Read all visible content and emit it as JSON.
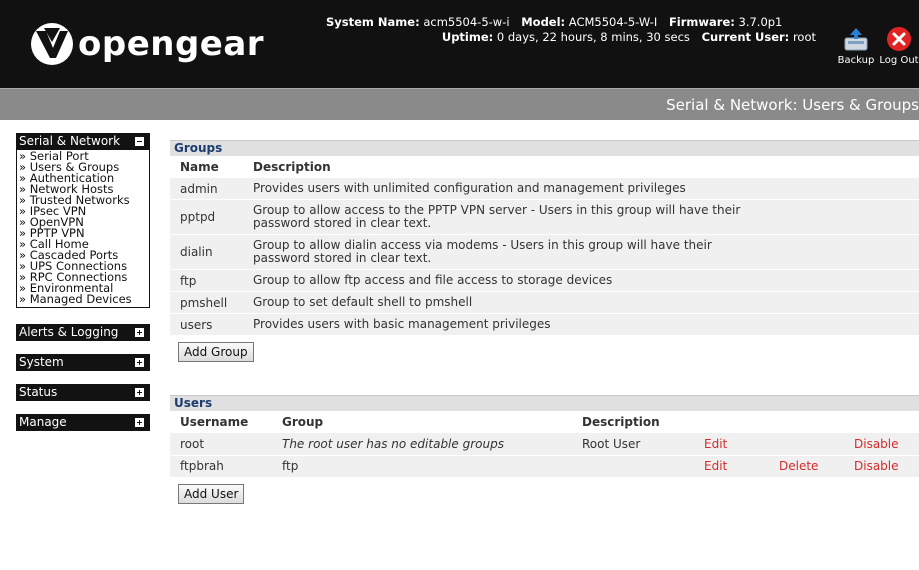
{
  "brand": {
    "name": "opengear"
  },
  "system": {
    "name_label": "System Name:",
    "name_value": "acm5504-5-w-i",
    "model_label": "Model:",
    "model_value": "ACM5504-5-W-I",
    "firmware_label": "Firmware:",
    "firmware_value": "3.7.0p1",
    "uptime_label": "Uptime:",
    "uptime_value": "0 days, 22 hours, 8 mins, 30 secs",
    "user_label": "Current User:",
    "user_value": "root"
  },
  "toolbar": {
    "backup_label": "Backup",
    "logout_label": "Log Out"
  },
  "page_title": "Serial & Network: Users & Groups",
  "sidebar": {
    "sections": [
      {
        "label": "Serial & Network",
        "expanded": true
      },
      {
        "label": "Alerts & Logging",
        "expanded": false
      },
      {
        "label": "System",
        "expanded": false
      },
      {
        "label": "Status",
        "expanded": false
      },
      {
        "label": "Manage",
        "expanded": false
      }
    ],
    "items": [
      "Serial Port",
      "Users & Groups",
      "Authentication",
      "Network Hosts",
      "Trusted Networks",
      "IPsec VPN",
      "OpenVPN",
      "PPTP VPN",
      "Call Home",
      "Cascaded Ports",
      "UPS Connections",
      "RPC Connections",
      "Environmental",
      "Managed Devices"
    ]
  },
  "groups": {
    "title": "Groups",
    "headers": {
      "name": "Name",
      "description": "Description"
    },
    "rows": [
      {
        "name": "admin",
        "desc1": "Provides users with unlimited configuration and management privileges",
        "desc2": ""
      },
      {
        "name": "pptpd",
        "desc1": "Group to allow access to the PPTP VPN server - Users in this group will have their",
        "desc2": "password stored in clear text."
      },
      {
        "name": "dialin",
        "desc1": "Group to allow dialin access via modems - Users in this group will have their",
        "desc2": "password stored in clear text."
      },
      {
        "name": "ftp",
        "desc1": "Group to allow ftp access and file access to storage devices",
        "desc2": ""
      },
      {
        "name": "pmshell",
        "desc1": "Group to set default shell to pmshell",
        "desc2": ""
      },
      {
        "name": "users",
        "desc1": "Provides users with basic management privileges",
        "desc2": ""
      }
    ],
    "add_label": "Add Group"
  },
  "users": {
    "title": "Users",
    "headers": {
      "username": "Username",
      "group": "Group",
      "description": "Description"
    },
    "rows": [
      {
        "username": "root",
        "group": "The root user has no editable groups",
        "description": "Root User",
        "edit": "Edit",
        "delete": "",
        "disable": "Disable"
      },
      {
        "username": "ftpbrah",
        "group": "ftp",
        "description": "",
        "edit": "Edit",
        "delete": "Delete",
        "disable": "Disable"
      }
    ],
    "add_label": "Add User"
  },
  "colors": {
    "header_bg": "#111111",
    "title_bar": "#8a8a8a",
    "section_head": "#e0e0e0",
    "section_text": "#1d3d70",
    "link_red": "#d42b2b"
  }
}
